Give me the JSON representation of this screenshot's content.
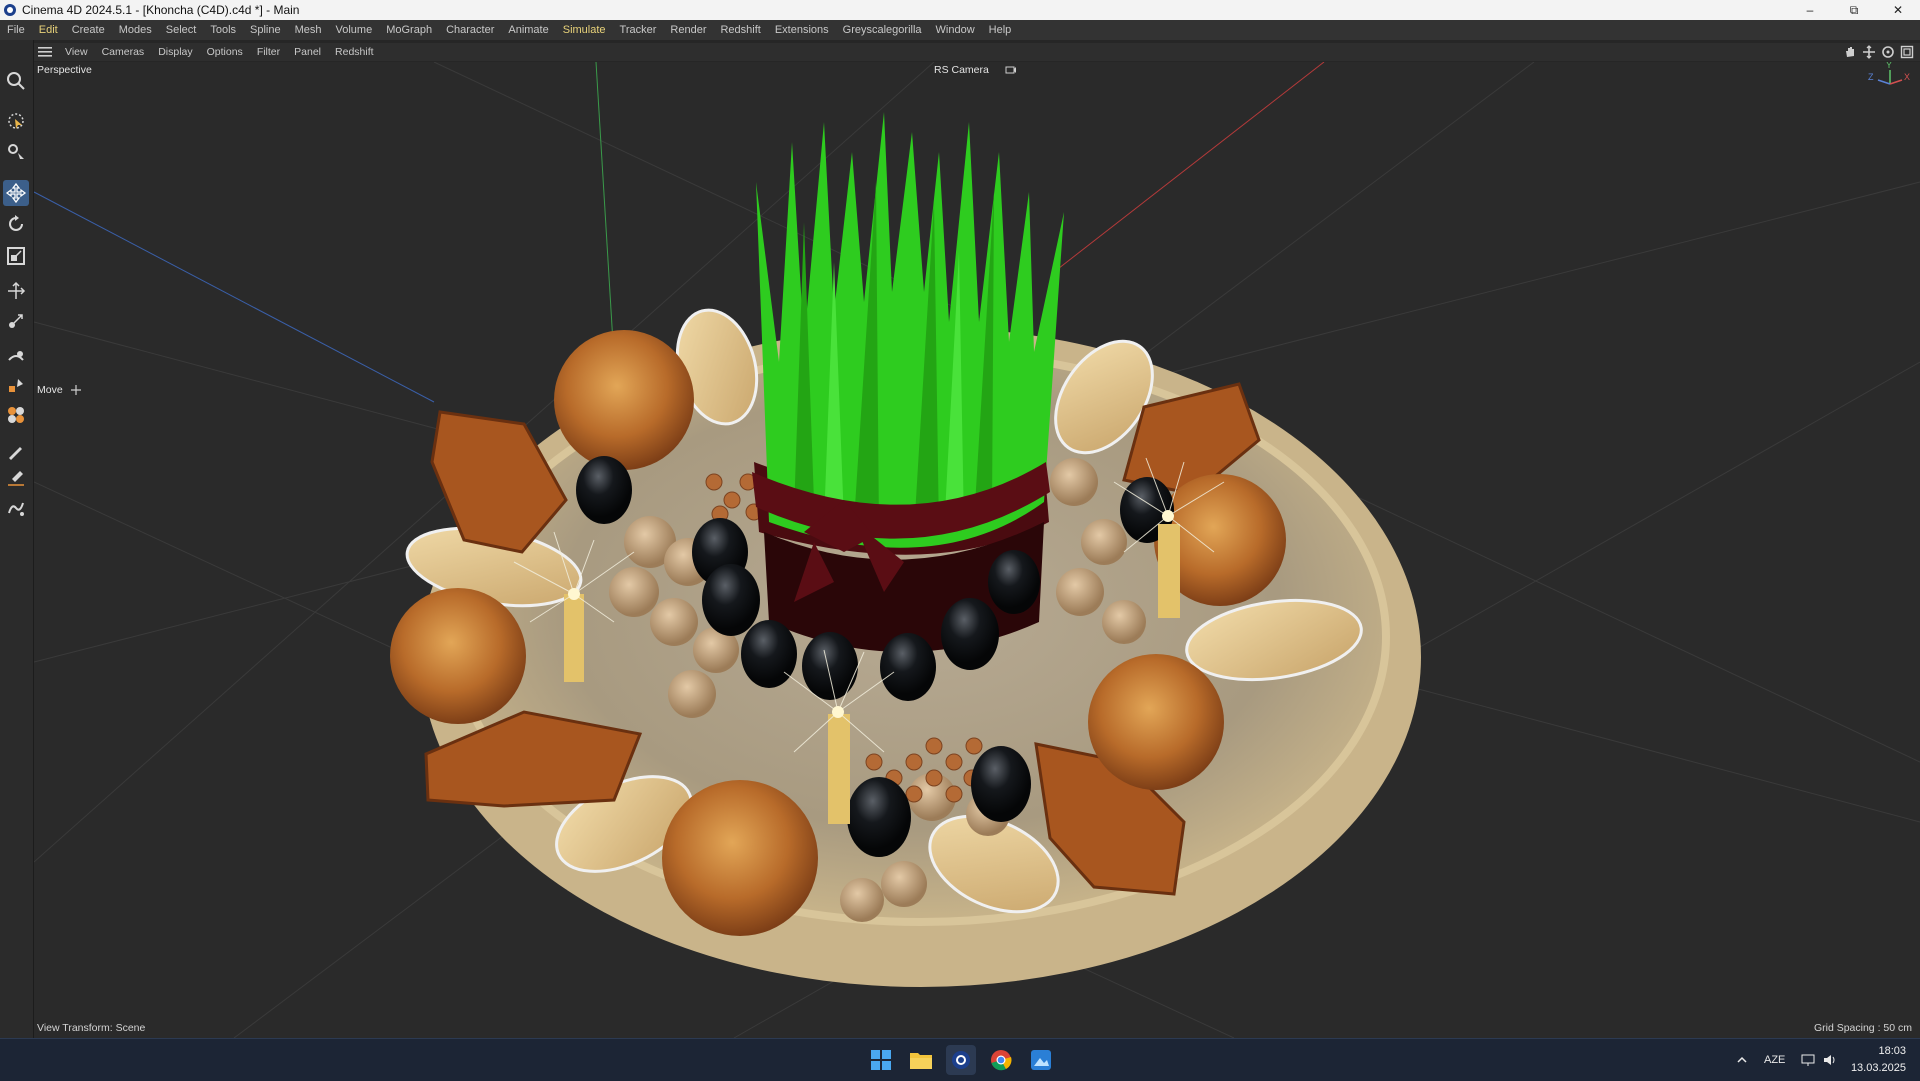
{
  "window": {
    "title": "Cinema 4D 2024.5.1 - [Khoncha (C4D).c4d *] - Main",
    "minimize": "–",
    "restore": "⧉",
    "close": "✕"
  },
  "menu": [
    "File",
    "Edit",
    "Create",
    "Modes",
    "Select",
    "Tools",
    "Spline",
    "Mesh",
    "Volume",
    "MoGraph",
    "Character",
    "Animate",
    "Simulate",
    "Tracker",
    "Render",
    "Redshift",
    "Extensions",
    "Greyscalegorilla",
    "Window",
    "Help"
  ],
  "viewport_menu": [
    "View",
    "Cameras",
    "Display",
    "Options",
    "Filter",
    "Panel",
    "Redshift"
  ],
  "viewport": {
    "projection": "Perspective",
    "camera": "RS Camera",
    "active_tool": "Move",
    "view_transform": "View Transform: Scene",
    "grid_spacing": "Grid Spacing : 50 cm",
    "axis_labels": {
      "z": "Z",
      "y": "Y",
      "x": "X"
    }
  },
  "tools": [
    "search-icon",
    "live-selection-icon",
    "tweak-icon",
    "move-icon",
    "rotate-icon",
    "scale-icon",
    "transform-icon",
    "snap-icon",
    "magnet-icon",
    "brush-icon",
    "fill-icon",
    "spline-pen-icon",
    "knife-icon",
    "sketch-icon"
  ],
  "taskbar": {
    "language": "AZE",
    "time": "18:03",
    "date": "13.03.2025"
  },
  "colors": {
    "accent": "#3c5f8a",
    "menu_highlight": "#e8d27a",
    "grass": "#2ecc1f",
    "ribbon": "#5a0d14",
    "basket": "#c9b48a"
  }
}
